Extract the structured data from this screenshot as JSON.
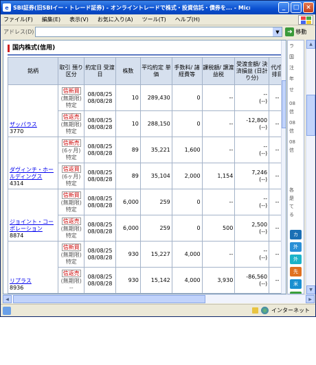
{
  "window": {
    "title": "SBI証券(旧SBIイー・トレード証券) - オンライントレードで株式・投資信託・債券を... - Micr...",
    "buttons": {
      "minimize": "_",
      "maximize": "□",
      "close": "×"
    }
  },
  "menu": [
    "ファイル(F)",
    "編集(E)",
    "表示(V)",
    "お気に入り(A)",
    "ツール(T)",
    "ヘルプ(H)"
  ],
  "address": {
    "label": "アドレス(D)",
    "value": "",
    "go_label": "移動"
  },
  "section_title": "国内株式(信用)",
  "columns": [
    "銘柄",
    "取引 預り区分",
    "約定日 受渡日",
    "株数",
    "平均約定 単価",
    "手数料/ 諸経費等",
    "課税額/ 譲渡益税",
    "受渡金額/ 決済損益 (日計り分)",
    "代/保 排目"
  ],
  "holdings": [
    {
      "name": "ザッパラス",
      "code": "3770",
      "rows": [
        {
          "kind": "信新買",
          "kind2": "(無期限)",
          "kind3": "特定",
          "date1": "08/08/25",
          "date2": "08/08/28",
          "qty": "10",
          "price": "289,430",
          "fee": "0",
          "tax": "--",
          "amount1": "--",
          "amount2": "(--)",
          "misc": "--"
        },
        {
          "kind": "信返売",
          "kind2": "(無期限)",
          "kind3": "特定",
          "date1": "08/08/25",
          "date2": "08/08/28",
          "qty": "10",
          "price": "288,150",
          "fee": "0",
          "tax": "--",
          "amount1": "-12,800",
          "amount2": "(--)",
          "misc": "--"
        }
      ]
    },
    {
      "name": "ダヴィンチ・ホールディングス",
      "code": "4314",
      "rows": [
        {
          "kind": "信新売",
          "kind2": "(6ヶ月)",
          "kind3": "特定",
          "date1": "08/08/25",
          "date2": "08/08/28",
          "qty": "89",
          "price": "35,221",
          "fee": "1,600",
          "tax": "--",
          "amount1": "--",
          "amount2": "(--)",
          "misc": "--"
        },
        {
          "kind": "信返買",
          "kind2": "(6ヶ月)",
          "kind3": "特定",
          "date1": "08/08/25",
          "date2": "08/08/28",
          "qty": "89",
          "price": "35,104",
          "fee": "2,000",
          "tax": "1,154",
          "amount1": "7,246",
          "amount2": "(--)",
          "misc": "--"
        }
      ]
    },
    {
      "name": "ジョイント・コーポレーション",
      "code": "8874",
      "rows": [
        {
          "kind": "信新買",
          "kind2": "(無期限)",
          "kind3": "特定",
          "date1": "08/08/25",
          "date2": "08/08/28",
          "qty": "6,000",
          "price": "259",
          "fee": "0",
          "tax": "--",
          "amount1": "--",
          "amount2": "(--)",
          "misc": "--"
        },
        {
          "kind": "信返売",
          "kind2": "(無期限)",
          "kind3": "特定",
          "date1": "08/08/25",
          "date2": "08/08/28",
          "qty": "6,000",
          "price": "259",
          "fee": "0",
          "tax": "500",
          "amount1": "2,500",
          "amount2": "(--)",
          "misc": "--"
        }
      ]
    },
    {
      "name": "リプラス",
      "code": "8936",
      "rows": [
        {
          "kind": "信新買",
          "kind2": "(無期限)",
          "kind3": "特定",
          "date1": "08/08/25",
          "date2": "08/08/28",
          "qty": "930",
          "price": "15,227",
          "fee": "4,000",
          "tax": "--",
          "amount1": "--",
          "amount2": "(--)",
          "misc": "--"
        },
        {
          "kind": "信返売",
          "kind2": "(無期限)",
          "kind3": "--",
          "date1": "08/08/25",
          "date2": "08/08/28",
          "qty": "930",
          "price": "15,142",
          "fee": "4,000",
          "tax": "3,930",
          "amount1": "-86,560",
          "amount2": "(--)",
          "misc": "--"
        }
      ]
    }
  ],
  "right_panel": {
    "items": [
      "ラ",
      "国",
      "注",
      "年",
      "せ",
      "08",
      "信",
      "08",
      "信",
      "08",
      "信",
      "各",
      "是",
      "て",
      "る"
    ],
    "buttons": [
      "カ",
      "外",
      "外",
      "先",
      "米",
      "中"
    ]
  },
  "status": {
    "zone": "インターネット"
  },
  "colors": {
    "titlebar": "#0a4fd0",
    "header_bg": "#d6e0ee",
    "link": "#0000ee",
    "section_accent": "#d02020"
  }
}
